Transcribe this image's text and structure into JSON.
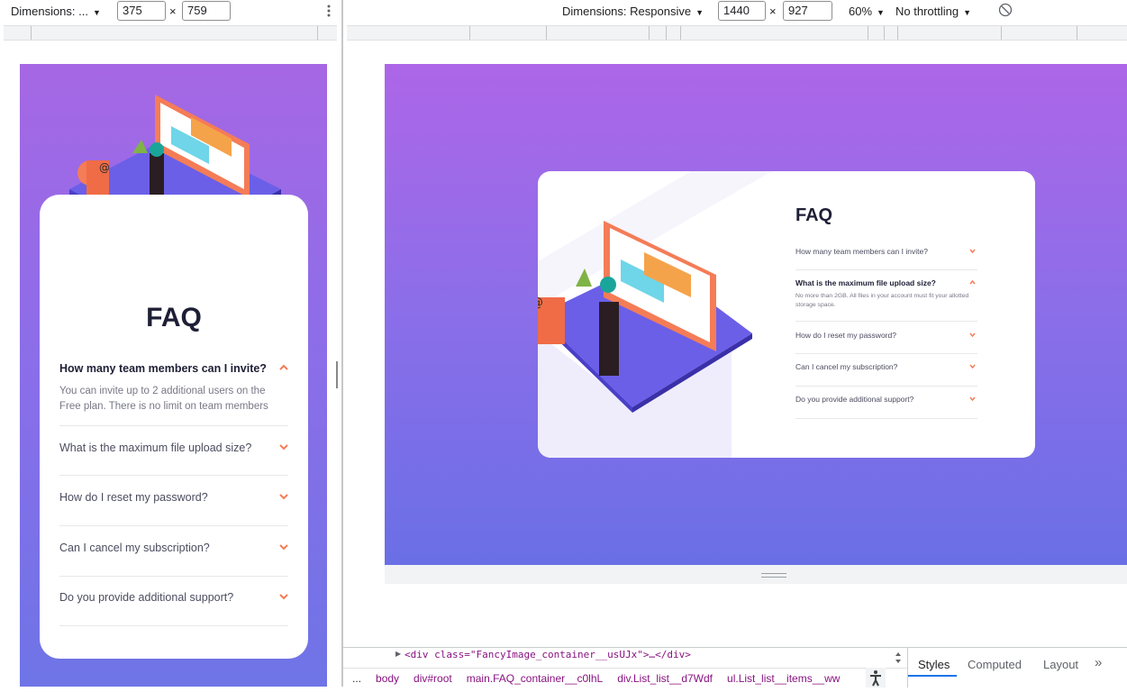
{
  "left_toolbar": {
    "dimensions_label": "Dimensions: ...",
    "width": "375",
    "times": "×",
    "height": "759",
    "menu_icon": "kebab-icon"
  },
  "right_toolbar": {
    "dimensions_label": "Dimensions: Responsive",
    "width": "1440",
    "times": "×",
    "height": "927",
    "zoom": "60%",
    "throttling": "No throttling",
    "rotate_icon": "rotate-icon"
  },
  "mobile_preview": {
    "title": "FAQ",
    "items": [
      {
        "question": "How many team members can I invite?",
        "answer": "You can invite up to 2 additional users on the Free plan. There is no limit on team members",
        "open": true
      },
      {
        "question": "What is the maximum file upload size?",
        "open": false
      },
      {
        "question": "How do I reset my password?",
        "open": false
      },
      {
        "question": "Can I cancel my subscription?",
        "open": false
      },
      {
        "question": "Do you provide additional support?",
        "open": false
      }
    ]
  },
  "desktop_preview": {
    "title": "FAQ",
    "items": [
      {
        "question": "How many team members can I invite?",
        "open": false
      },
      {
        "question": "What is the maximum file upload size?",
        "answer": "No more than 2GB. All files in your account must fit your allotted storage space.",
        "open": true
      },
      {
        "question": "How do I reset my password?",
        "open": false
      },
      {
        "question": "Can I cancel my subscription?",
        "open": false
      },
      {
        "question": "Do you provide additional support?",
        "open": false
      }
    ]
  },
  "devtools": {
    "code_line": "<div class=\"FancyImage_container__usUJx\">…</div>",
    "breadcrumbs": [
      "body",
      "div#root",
      "main.FAQ_container__c0lhL",
      "div.List_list__d7Wdf",
      "ul.List_list__items__ww"
    ],
    "more": "...",
    "tabs": [
      "Styles",
      "Computed",
      "Layout"
    ],
    "more_tabs": "»"
  },
  "colors": {
    "accent": "#f47c57",
    "gradient_top": "#af67e9",
    "gradient_bottom": "#6565e7",
    "heading": "#1e1f36"
  }
}
